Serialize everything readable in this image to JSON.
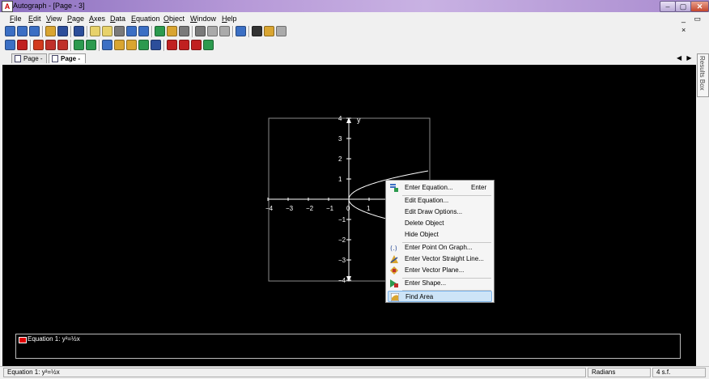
{
  "window": {
    "title": "Autograph - [Page - 3]",
    "app_icon": "autograph-icon",
    "min": "–",
    "max": "▢",
    "close": "✕"
  },
  "menu": [
    {
      "pre": "",
      "u": "F",
      "post": "ile"
    },
    {
      "pre": "",
      "u": "E",
      "post": "dit"
    },
    {
      "pre": "",
      "u": "V",
      "post": "iew"
    },
    {
      "pre": "",
      "u": "P",
      "post": "age"
    },
    {
      "pre": "",
      "u": "A",
      "post": "xes"
    },
    {
      "pre": "",
      "u": "D",
      "post": "ata"
    },
    {
      "pre": "",
      "u": "E",
      "post": "quation"
    },
    {
      "pre": "",
      "u": "O",
      "post": "bject"
    },
    {
      "pre": "",
      "u": "W",
      "post": "indow"
    },
    {
      "pre": "",
      "u": "H",
      "post": "elp"
    }
  ],
  "mdi_controls": "_ ▭ ×",
  "toolbar1": [
    {
      "name": "new-page-icon",
      "color": "#3b6fc4"
    },
    {
      "name": "new-3d-page-icon",
      "color": "#3b6fc4"
    },
    {
      "name": "new-blank-icon",
      "color": "#3b6fc4"
    },
    {
      "name": "open-folder-icon",
      "color": "#d9a531"
    },
    {
      "name": "save-icon",
      "color": "#2c4e9a"
    },
    {
      "name": "undo-icon",
      "color": "#2c4e9a"
    },
    {
      "name": "select-mode-icon",
      "color": "#e8d26a"
    },
    {
      "name": "zoom-box-icon",
      "color": "#e8d26a"
    },
    {
      "name": "text-box-icon",
      "color": "#7a7a7a"
    },
    {
      "name": "scribble-icon",
      "color": "#3b6fc4"
    },
    {
      "name": "table-icon",
      "color": "#3b6fc4"
    },
    {
      "name": "slideshow-icon",
      "color": "#2c9a4e"
    },
    {
      "name": "edit-draw-icon",
      "color": "#d9a531"
    },
    {
      "name": "zoom-icon",
      "color": "#7a7a7a"
    },
    {
      "name": "magnifier-icon",
      "color": "#7a7a7a"
    },
    {
      "name": "hand-icon",
      "color": "#aaaaaa"
    },
    {
      "name": "pin-icon",
      "color": "#aaaaaa"
    },
    {
      "name": "present-icon",
      "color": "#3b6fc4"
    },
    {
      "name": "line-style-icon",
      "color": "#333333"
    },
    {
      "name": "pen-color-icon",
      "color": "#d9a531"
    },
    {
      "name": "fill-color-icon",
      "color": "#aaaaaa"
    }
  ],
  "toolbar2": [
    {
      "name": "axes-icon",
      "color": "#3b6fc4"
    },
    {
      "name": "tangent-icon",
      "color": "#c02020"
    },
    {
      "name": "gradient-icon",
      "color": "#d23a1e"
    },
    {
      "name": "point-plot-icon",
      "color": "#c0302a"
    },
    {
      "name": "data-set-icon",
      "color": "#c0302a"
    },
    {
      "name": "grid-icon",
      "color": "#2c9a4e"
    },
    {
      "name": "graph-page-icon",
      "color": "#2c9a4e"
    },
    {
      "name": "enter-equation-icon",
      "color": "#3b6fc4"
    },
    {
      "name": "vector-line-icon",
      "color": "#d9a531"
    },
    {
      "name": "vector-plane-icon",
      "color": "#d9a531"
    },
    {
      "name": "shape-icon",
      "color": "#2c9a4e"
    },
    {
      "name": "point-icon",
      "color": "#2c4e9a"
    },
    {
      "name": "transform-icon",
      "color": "#c02020"
    },
    {
      "name": "reflect-icon",
      "color": "#c02020"
    },
    {
      "name": "rotate-icon",
      "color": "#c02020"
    },
    {
      "name": "turtle-icon",
      "color": "#2c9a4e"
    }
  ],
  "tabs": [
    {
      "label": "Page - 1"
    },
    {
      "label": "Page - 3"
    }
  ],
  "tab_nav": "◀ ▶ ✕",
  "results_box": "Results Box",
  "graph": {
    "x_ticks": [
      "-4",
      "-3",
      "-2",
      "-1",
      "0",
      "1"
    ],
    "y_ticks": [
      "4",
      "3",
      "2",
      "1",
      "0",
      "-1",
      "-2",
      "-3",
      "-4"
    ],
    "y_label": "y"
  },
  "context_menu": {
    "enter_equation": "Enter Equation...",
    "enter_key": "Enter",
    "edit_equation": "Edit Equation...",
    "edit_draw_options": "Edit Draw Options...",
    "delete_object": "Delete Object",
    "hide_object": "Hide Object",
    "enter_point": "Enter Point On Graph...",
    "enter_vector_line": "Enter Vector Straight Line...",
    "enter_vector_plane": "Enter Vector Plane...",
    "enter_shape": "Enter Shape...",
    "find_area": "Find Area"
  },
  "legend": {
    "text": "Equation 1: y²=½x",
    "swatch_color": "#e00000"
  },
  "status": {
    "equation": "Equation 1: y²=½x",
    "angle": "Radians",
    "sig_figs": "4 s.f."
  }
}
